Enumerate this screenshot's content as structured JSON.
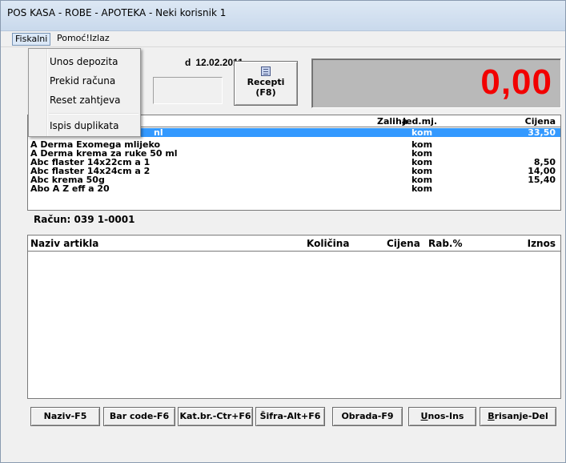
{
  "window": {
    "title": "POS KASA - ROBE - APOTEKA - Neki korisnik 1"
  },
  "menu": {
    "items": [
      "Fiskalni",
      "Pomoć!",
      "Izlaz"
    ]
  },
  "dropdown": {
    "items": [
      "Unos depozita",
      "Prekid računa",
      "Reset zahtjeva",
      "Ispis duplikata"
    ]
  },
  "header": {
    "date_prefix": "d",
    "date": "12.02.2011",
    "recepti_label": "Recepti",
    "recepti_shortcut": "(F8)",
    "total": "0,00"
  },
  "articles": {
    "columns": {
      "stock": "Zaliha",
      "unit": "Jed.mj.",
      "price": "Cijena"
    },
    "rows": [
      {
        "name": "nl",
        "unit": "kom",
        "price": "33,50",
        "selected": true
      },
      {
        "name": "A Derma Exomega mlijeko",
        "unit": "kom",
        "price": ""
      },
      {
        "name": "A Derma krema za ruke 50 ml",
        "unit": "kom",
        "price": ""
      },
      {
        "name": "Abc flaster 14x22cm a 1",
        "unit": "kom",
        "price": "8,50"
      },
      {
        "name": "Abc flaster 14x24cm a 2",
        "unit": "kom",
        "price": "14,00"
      },
      {
        "name": "Abc krema 50g",
        "unit": "kom",
        "price": "15,40"
      },
      {
        "name": "Abo A Z eff a 20",
        "unit": "kom",
        "price": ""
      }
    ]
  },
  "receipt": {
    "label": "Račun: 039 1-0001",
    "columns": {
      "name": "Naziv artikla",
      "qty": "Količina",
      "price": "Cijena",
      "discount": "Rab.%",
      "amount": "Iznos"
    }
  },
  "buttons": {
    "naziv": "Naziv-F5",
    "barcode": "Bar code-F6",
    "katbr": "Kat.br.-Ctr+F6",
    "sifra": "Šifra-Alt+F6",
    "obrada": "Obrada-F9",
    "unos_u": "U",
    "unos_rest": "nos-Ins",
    "brisanje_u": "B",
    "brisanje_rest": "risanje-Del"
  }
}
